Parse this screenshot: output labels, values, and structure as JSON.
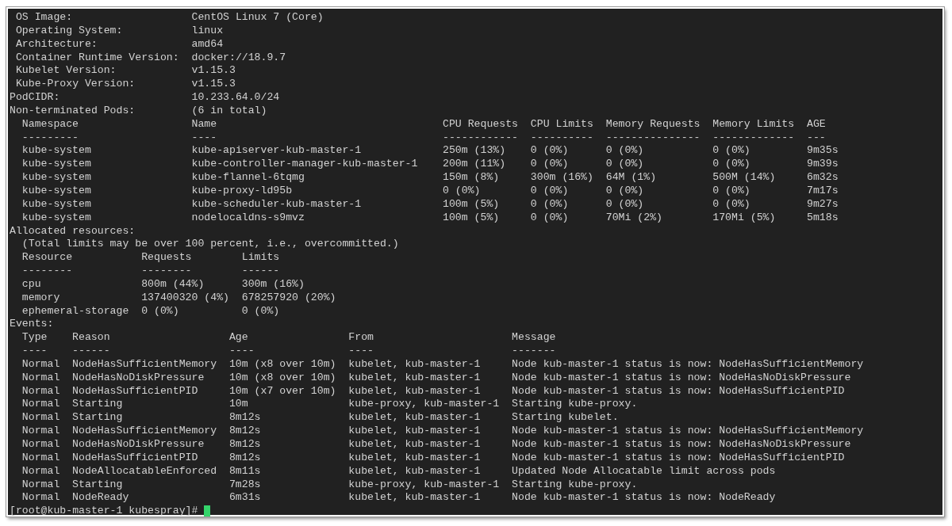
{
  "system_info": [
    {
      "label": "OS Image:",
      "value": "CentOS Linux 7 (Core)"
    },
    {
      "label": "Operating System:",
      "value": "linux"
    },
    {
      "label": "Architecture:",
      "value": "amd64"
    },
    {
      "label": "Container Runtime Version:",
      "value": "docker://18.9.7"
    },
    {
      "label": "Kubelet Version:",
      "value": "v1.15.3"
    },
    {
      "label": "Kube-Proxy Version:",
      "value": "v1.15.3"
    }
  ],
  "pod_cidr": {
    "label": "PodCIDR:",
    "value": "10.233.64.0/24"
  },
  "pods": {
    "label": "Non-terminated Pods:",
    "value": "(6 in total)",
    "columns": [
      {
        "label": "Namespace",
        "rule": "---------"
      },
      {
        "label": "Name",
        "rule": "----"
      },
      {
        "label": "CPU Requests",
        "rule": "------------"
      },
      {
        "label": "CPU Limits",
        "rule": "----------"
      },
      {
        "label": "Memory Requests",
        "rule": "---------------"
      },
      {
        "label": "Memory Limits",
        "rule": "-------------"
      },
      {
        "label": "AGE",
        "rule": "---"
      }
    ],
    "rows": [
      [
        "kube-system",
        "kube-apiserver-kub-master-1",
        "250m (13%)",
        "0 (0%)",
        "0 (0%)",
        "0 (0%)",
        "9m35s"
      ],
      [
        "kube-system",
        "kube-controller-manager-kub-master-1",
        "200m (11%)",
        "0 (0%)",
        "0 (0%)",
        "0 (0%)",
        "9m39s"
      ],
      [
        "kube-system",
        "kube-flannel-6tqmg",
        "150m (8%)",
        "300m (16%)",
        "64M (1%)",
        "500M (14%)",
        "6m32s"
      ],
      [
        "kube-system",
        "kube-proxy-ld95b",
        "0 (0%)",
        "0 (0%)",
        "0 (0%)",
        "0 (0%)",
        "7m17s"
      ],
      [
        "kube-system",
        "kube-scheduler-kub-master-1",
        "100m (5%)",
        "0 (0%)",
        "0 (0%)",
        "0 (0%)",
        "9m27s"
      ],
      [
        "kube-system",
        "nodelocaldns-s9mvz",
        "100m (5%)",
        "0 (0%)",
        "70Mi (2%)",
        "170Mi (5%)",
        "5m18s"
      ]
    ]
  },
  "allocated": {
    "label": "Allocated resources:",
    "note": "(Total limits may be over 100 percent, i.e., overcommitted.)",
    "columns": [
      {
        "label": "Resource",
        "rule": "--------"
      },
      {
        "label": "Requests",
        "rule": "--------"
      },
      {
        "label": "Limits",
        "rule": "------"
      }
    ],
    "rows": [
      [
        "cpu",
        "800m (44%)",
        "300m (16%)"
      ],
      [
        "memory",
        "137400320 (4%)",
        "678257920 (20%)"
      ],
      [
        "ephemeral-storage",
        "0 (0%)",
        "0 (0%)"
      ]
    ]
  },
  "events": {
    "label": "Events:",
    "columns": [
      {
        "label": "Type",
        "rule": "----"
      },
      {
        "label": "Reason",
        "rule": "------"
      },
      {
        "label": "Age",
        "rule": "----"
      },
      {
        "label": "From",
        "rule": "----"
      },
      {
        "label": "Message",
        "rule": "-------"
      }
    ],
    "rows": [
      [
        "Normal",
        "NodeHasSufficientMemory",
        "10m (x8 over 10m)",
        "kubelet, kub-master-1",
        "Node kub-master-1 status is now: NodeHasSufficientMemory"
      ],
      [
        "Normal",
        "NodeHasNoDiskPressure",
        "10m (x8 over 10m)",
        "kubelet, kub-master-1",
        "Node kub-master-1 status is now: NodeHasNoDiskPressure"
      ],
      [
        "Normal",
        "NodeHasSufficientPID",
        "10m (x7 over 10m)",
        "kubelet, kub-master-1",
        "Node kub-master-1 status is now: NodeHasSufficientPID"
      ],
      [
        "Normal",
        "Starting",
        "10m",
        "kube-proxy, kub-master-1",
        "Starting kube-proxy."
      ],
      [
        "Normal",
        "Starting",
        "8m12s",
        "kubelet, kub-master-1",
        "Starting kubelet."
      ],
      [
        "Normal",
        "NodeHasSufficientMemory",
        "8m12s",
        "kubelet, kub-master-1",
        "Node kub-master-1 status is now: NodeHasSufficientMemory"
      ],
      [
        "Normal",
        "NodeHasNoDiskPressure",
        "8m12s",
        "kubelet, kub-master-1",
        "Node kub-master-1 status is now: NodeHasNoDiskPressure"
      ],
      [
        "Normal",
        "NodeHasSufficientPID",
        "8m12s",
        "kubelet, kub-master-1",
        "Node kub-master-1 status is now: NodeHasSufficientPID"
      ],
      [
        "Normal",
        "NodeAllocatableEnforced",
        "8m11s",
        "kubelet, kub-master-1",
        "Updated Node Allocatable limit across pods"
      ],
      [
        "Normal",
        "Starting",
        "7m28s",
        "kube-proxy, kub-master-1",
        "Starting kube-proxy."
      ],
      [
        "Normal",
        "NodeReady",
        "6m31s",
        "kubelet, kub-master-1",
        "Node kub-master-1 status is now: NodeReady"
      ]
    ]
  },
  "prompt": "[root@kub-master-1 kubespray]#"
}
